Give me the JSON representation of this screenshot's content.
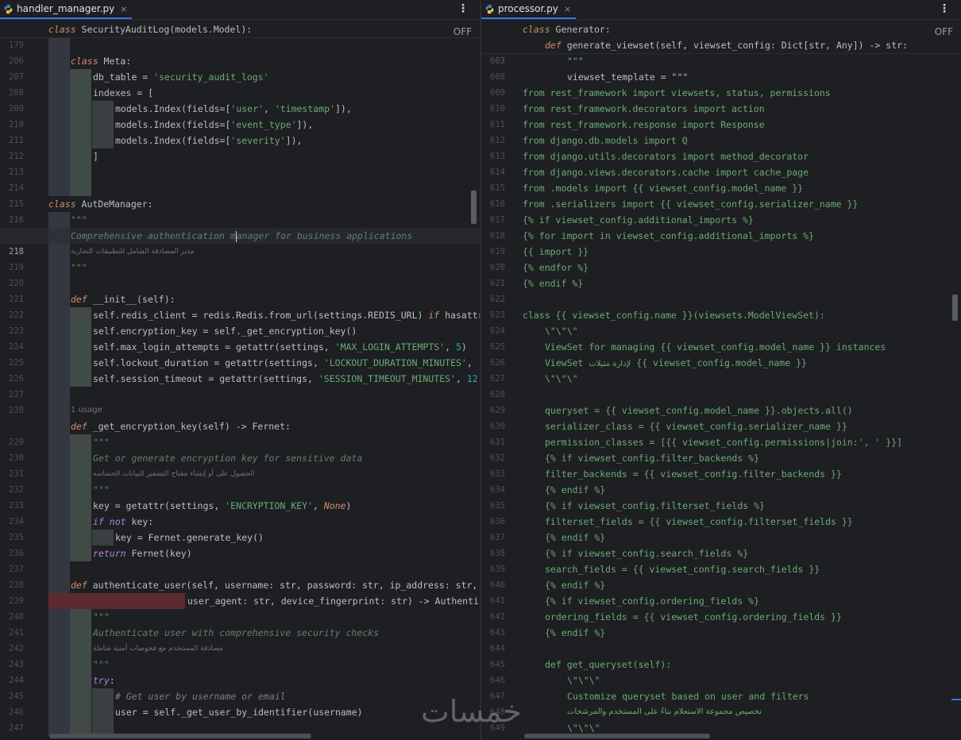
{
  "left": {
    "tab": "handler_manager.py",
    "close": "×",
    "menu": "⋮",
    "off": "OFF",
    "sticky": {
      "ln": "179",
      "kw": "class",
      "rest": " SecurityAuditLog(models.Model):"
    },
    "lines": {
      "l206": "206",
      "l207": "207",
      "l208": "208",
      "l209": "209",
      "l210": "210",
      "l211": "211",
      "l212": "212",
      "l213": "213",
      "l214": "214",
      "l215": "215",
      "l216": "216",
      "l217": "217",
      "l218": "218",
      "l219": "219",
      "l220": "220",
      "l221": "221",
      "l222": "222",
      "l223": "223",
      "l224": "224",
      "l225": "225",
      "l226": "226",
      "l227": "227",
      "l228": "228",
      "l229": "229",
      "l230": "230",
      "l231": "231",
      "l232": "232",
      "l233": "233",
      "l234": "234",
      "l235": "235",
      "l236": "236",
      "l237": "237",
      "l238": "238",
      "l239": "239",
      "l240": "240",
      "l241": "241",
      "l242": "242",
      "l243": "243",
      "l244": "244",
      "l245": "245",
      "l246": "246",
      "l247": "247",
      "l248": "248"
    },
    "code": {
      "c207_kw": "class",
      "c207": " Meta:",
      "c208": "db_table = ",
      "c208_s": "'security_audit_logs'",
      "c209": "indexes = [",
      "c210_a": "models.Index(fields=[",
      "c210_s1": "'user'",
      "c210_b": ", ",
      "c210_s2": "'timestamp'",
      "c210_c": "]),",
      "c211_a": "models.Index(fields=[",
      "c211_s": "'event_type'",
      "c211_c": "]),",
      "c212_a": "models.Index(fields=[",
      "c212_s": "'severity'",
      "c212_c": "]),",
      "c213": "]",
      "c216_kw": "class",
      "c216": " AutDeManager:",
      "c217": "\"\"\"",
      "c218_a": "Comprehensive authentication m",
      "c218_b": "anager for business applications",
      "c219": "مدير المصادقة الشامل للتطبيقات التجارية",
      "c220": "\"\"\"",
      "c222_kw": "def",
      "c222": " __init__(self):",
      "c223_a": "self.redis_client = redis.Redis.from_url(settings.REDIS_URL) ",
      "c223_kw": "if",
      "c223_b": " hasattr",
      "c224": "self.encryption_key = self._get_encryption_key()",
      "c225_a": "self.max_login_attempts = getattr(settings, ",
      "c225_s": "'MAX_LOGIN_ATTEMPTS'",
      "c225_b": ", ",
      "c225_n": "5",
      "c225_c": ")",
      "c226_a": "self.lockout_duration = getattr(settings, ",
      "c226_s": "'LOCKOUT_DURATION_MINUTES'",
      "c226_b": ", ",
      "c227_a": "self.session_timeout = getattr(settings, ",
      "c227_s": "'SESSION_TIMEOUT_MINUTES'",
      "c227_b": ", ",
      "c227_n": "12",
      "usage": "1 usage",
      "c229_kw": "def",
      "c229": " _get_encryption_key(self) -> Fernet:",
      "c230": "\"\"\"",
      "c231": "Get or generate encryption key for sensitive data",
      "c232": "الحصول على أو إنشاء مفتاح التشفير للبيانات الحساسة",
      "c233": "\"\"\"",
      "c234_a": "key = getattr(settings, ",
      "c234_s": "'ENCRYPTION_KEY'",
      "c234_b": ", ",
      "c234_kw": "None",
      "c234_c": ")",
      "c235_kw1": "if",
      "c235_kw2": " not",
      "c235": " key:",
      "c236": "key = Fernet.generate_key()",
      "c237_kw": "return",
      "c237": " Fernet(key)",
      "c239_kw": "def",
      "c239": " authenticate_user(self, username: str, password: str, ip_address: str, ",
      "c240": "user_agent: str, device_fingerprint: str) -> Authentic",
      "c241": "\"\"\"",
      "c242": "Authenticate user with comprehensive security checks",
      "c243": "مصادقة المستخدم مع فحوصات أمنية شاملة",
      "c244": "\"\"\"",
      "c245_kw": "try",
      "c245": ":",
      "c246": "# Get user by username or email",
      "c247": "user = self._get_user_by_identifier(username)"
    }
  },
  "right": {
    "tab": "processor.py",
    "close": "×",
    "menu": "⋮",
    "off": "OFF",
    "sticky1": {
      "ln": "419",
      "kw": "class",
      "rest": " Generator:"
    },
    "sticky2": {
      "ln": "603",
      "kw": "def",
      "rest": " generate_viewset(self, viewset_config: Dict[str, Any]) -> str:"
    },
    "lines": {
      "r607": "607",
      "r608": "608",
      "r609": "609",
      "r610": "610",
      "r611": "611",
      "r612": "612",
      "r613": "613",
      "r614": "614",
      "r615": "615",
      "r616": "616",
      "r617": "617",
      "r618": "618",
      "r619": "619",
      "r620": "620",
      "r621": "621",
      "r622": "622",
      "r623": "623",
      "r624": "624",
      "r625": "625",
      "r626": "626",
      "r627": "627",
      "r628": "628",
      "r629": "629",
      "r630": "630",
      "r631": "631",
      "r632": "632",
      "r633": "633",
      "r634": "634",
      "r635": "635",
      "r636": "636",
      "r637": "637",
      "r638": "638",
      "r639": "639",
      "r640": "640",
      "r641": "641",
      "r642": "642",
      "r643": "643",
      "r644": "644",
      "r645": "645",
      "r646": "646",
      "r647": "647",
      "r648": "648",
      "r649": "649"
    },
    "code": {
      "r607": "\"\"\"",
      "r608": "viewset_template = \"\"\"",
      "r609": "from rest_framework import viewsets, status, permissions",
      "r610": "from rest_framework.decorators import action",
      "r611": "from rest_framework.response import Response",
      "r612": "from django.db.models import Q",
      "r613": "from django.utils.decorators import method_decorator",
      "r614": "from django.views.decorators.cache import cache_page",
      "r615": "from .models import {{ viewset_config.model_name }}",
      "r616": "from .serializers import {{ viewset_config.serializer_name }}",
      "r617": "{% if viewset_config.additional_imports %}",
      "r618": "{% for import in viewset_config.additional_imports %}",
      "r619": "{{ import }}",
      "r620": "{% endfor %}",
      "r621": "{% endif %}",
      "r623": "class {{ viewset_config.name }}(viewsets.ModelViewSet):",
      "r624": "\\\"\\\"\\\"",
      "r625": "ViewSet for managing {{ viewset_config.model_name }} instances",
      "r626_a": "ViewSet ",
      "r626_ar": "لإدارة مثيلات",
      "r626_b": " {{ viewset_config.model_name }}",
      "r627": "\\\"\\\"\\\"",
      "r629": "queryset = {{ viewset_config.model_name }}.objects.all()",
      "r630": "serializer_class = {{ viewset_config.serializer_name }}",
      "r631": "permission_classes = [{{ viewset_config.permissions|join:', ' }}]",
      "r632": "{% if viewset_config.filter_backends %}",
      "r633": "filter_backends = {{ viewset_config.filter_backends }}",
      "r634": "{% endif %}",
      "r635": "{% if viewset_config.filterset_fields %}",
      "r636": "filterset_fields = {{ viewset_config.filterset_fields }}",
      "r637": "{% endif %}",
      "r638": "{% if viewset_config.search_fields %}",
      "r639": "search_fields = {{ viewset_config.search_fields }}",
      "r640": "{% endif %}",
      "r641": "{% if viewset_config.ordering_fields %}",
      "r642": "ordering_fields = {{ viewset_config.ordering_fields }}",
      "r643": "{% endif %}",
      "r645": "def get_queryset(self):",
      "r646": "\\\"\\\"\\\"",
      "r647": "Customize queryset based on user and filters",
      "r648": "تخصيص مجموعة الاستعلام بناءً على المستخدم والمرشحات",
      "r649": "\\\"\\\"\\\""
    }
  },
  "watermark": "خمسات",
  "colors": {
    "accent": "#3574f0",
    "keyword": "#cf8e6d",
    "string": "#6aab73",
    "docstring": "#5f826b",
    "background": "#1e1f22"
  }
}
